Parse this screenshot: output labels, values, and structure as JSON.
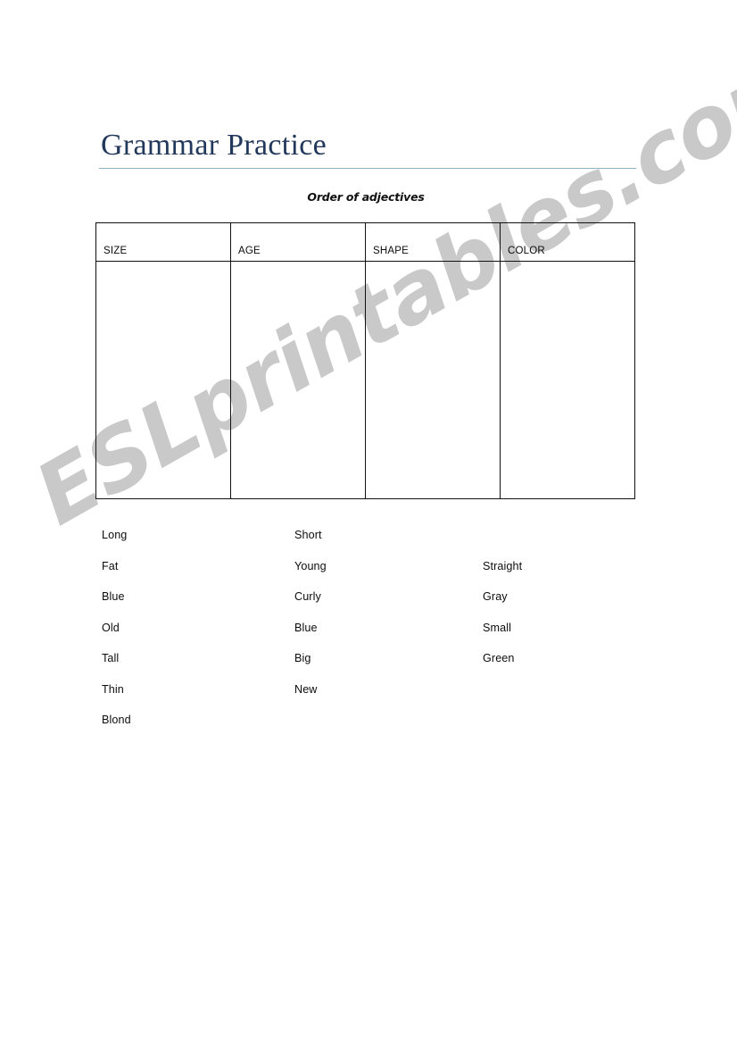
{
  "document": {
    "title": "Grammar Practice",
    "subtitle": "Order of adjectives"
  },
  "table": {
    "headers": [
      "SIZE",
      "AGE",
      "SHAPE",
      "COLOR"
    ],
    "rows": [
      [
        "",
        "",
        "",
        ""
      ]
    ]
  },
  "word_bank": {
    "columns": [
      {
        "name": "column-1",
        "words": [
          "Long",
          "Fat",
          "Blue",
          "Old",
          "Tall",
          "Thin",
          "Blond"
        ]
      },
      {
        "name": "column-2",
        "words": [
          "Short",
          "Young",
          "Curly",
          "Blue",
          "Big",
          "New"
        ]
      },
      {
        "name": "column-3",
        "words": [
          "",
          "Straight",
          "Gray",
          "Small",
          "Green"
        ]
      }
    ]
  },
  "watermark": {
    "text": "ESLprintables.com",
    "color": "#c9c9c9"
  },
  "colors": {
    "title": "#23395b",
    "rule": "#8fb3c4",
    "border": "#111111",
    "text": "#0d0d0d",
    "background": "#ffffff"
  }
}
